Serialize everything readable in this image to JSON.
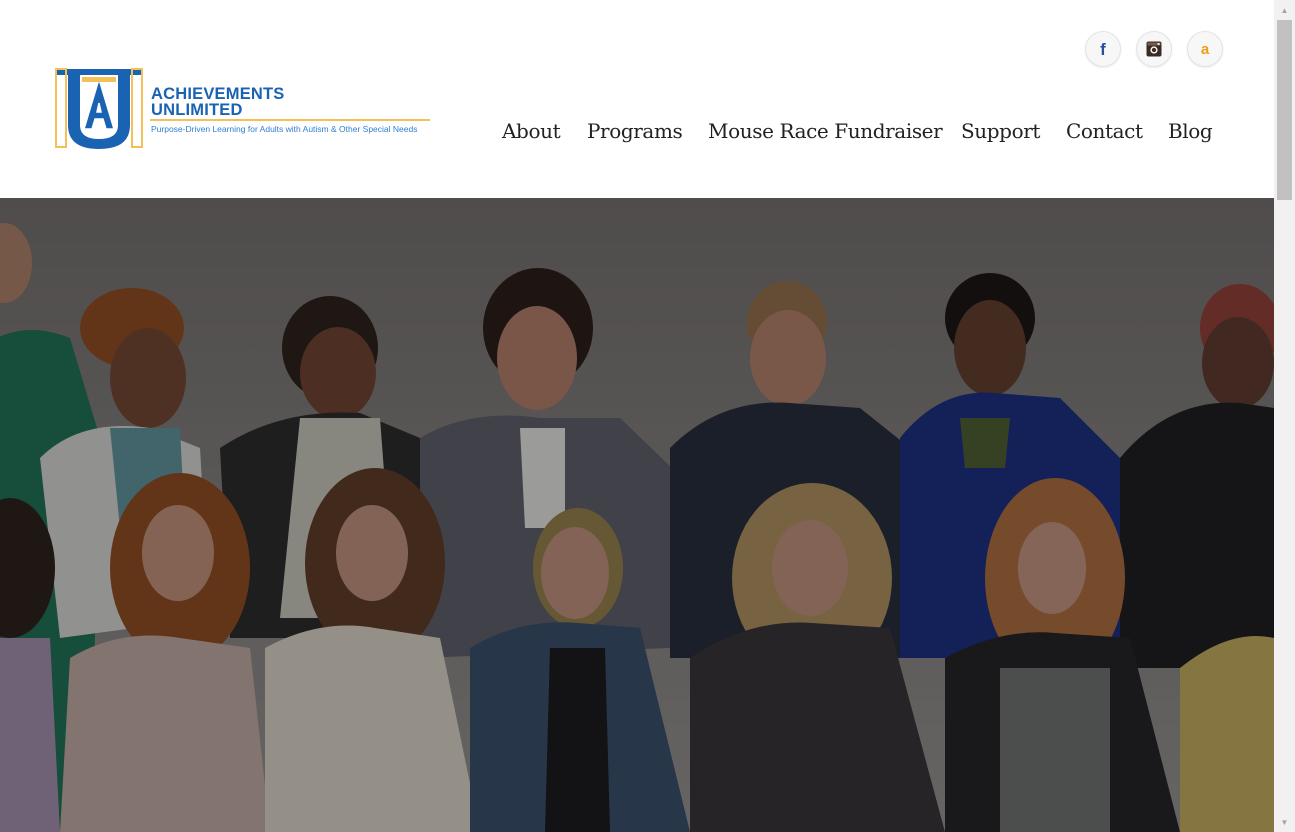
{
  "brand": {
    "name_line1": "ACHIEVEMENTS",
    "name_line2": "UNLIMITED",
    "tagline": "Purpose-Driven Learning for Adults with Autism & Other Special Needs",
    "monogram": "AU",
    "colors": {
      "blue": "#1a63b3",
      "gold": "#f3c05a"
    }
  },
  "social": [
    {
      "name": "facebook",
      "icon": "facebook-icon",
      "glyph": "f"
    },
    {
      "name": "instagram",
      "icon": "instagram-icon"
    },
    {
      "name": "amazon",
      "icon": "amazon-icon",
      "glyph": "a"
    }
  ],
  "nav": {
    "items": [
      {
        "label": "About"
      },
      {
        "label": "Programs"
      },
      {
        "label": "Mouse Race Fundraiser"
      },
      {
        "label": "Support"
      },
      {
        "label": "Contact"
      },
      {
        "label": "Blog"
      }
    ]
  },
  "hero": {
    "image": "group-photo-of-staff",
    "overlay_color": "#000000",
    "overlay_opacity": 0.35
  },
  "scrollbar": {
    "up_icon": "chevron-up-icon",
    "down_icon": "chevron-down-icon"
  }
}
